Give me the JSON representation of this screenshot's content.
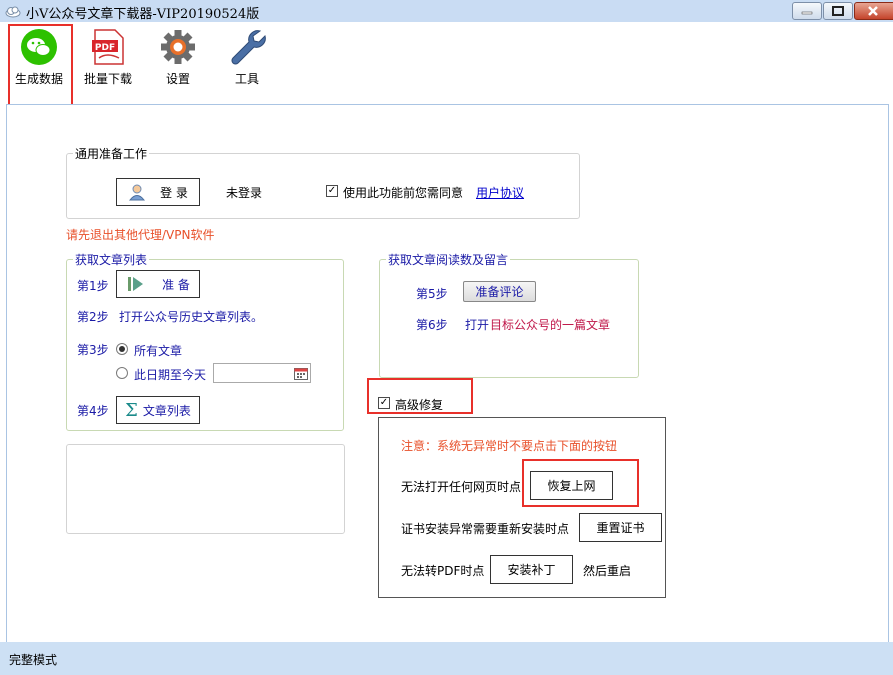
{
  "window": {
    "title": "小V公众号文章下载器-VIP20190524版"
  },
  "toolbar": {
    "generate": "生成数据",
    "batch": "批量下载",
    "settings": "设置",
    "tools": "工具"
  },
  "prep": {
    "legend": "通用准备工作",
    "login_label": "登 录",
    "status": "未登录",
    "consent": "使用此功能前您需同意",
    "agreement": "用户协议"
  },
  "proxy_warning": "请先退出其他代理/VPN软件",
  "article_list": {
    "legend": "获取文章列表",
    "step1": "第1步",
    "prepare": "准 备",
    "step2": "第2步",
    "step2_text": "打开公众号历史文章列表。",
    "step3": "第3步",
    "all_articles": "所有文章",
    "date_range": "此日期至今天",
    "step4": "第4步",
    "article_list_btn": "文章列表"
  },
  "reads": {
    "legend": "获取文章阅读数及留言",
    "step5": "第5步",
    "prepare_comments": "准备评论",
    "step6": "第6步",
    "step6_prefix": "打开",
    "step6_target": "目标公众号的一篇文章"
  },
  "advanced": {
    "label": "高级修复",
    "note": "注意：系统无异常时不要点击下面的按钮",
    "net_label": "无法打开任何网页时点",
    "restore_net": "恢复上网",
    "cert_label": "证书安装异常需要重新安装时点",
    "reset_cert": "重置证书",
    "pdf_label": "无法转PDF时点",
    "install_patch": "安装补丁",
    "restart": "然后重启"
  },
  "status_bar": {
    "mode": "完整模式"
  },
  "colors": {
    "accent_red": "#e8302a",
    "wechat_green": "#2dc100",
    "link_blue": "#0000cc"
  }
}
